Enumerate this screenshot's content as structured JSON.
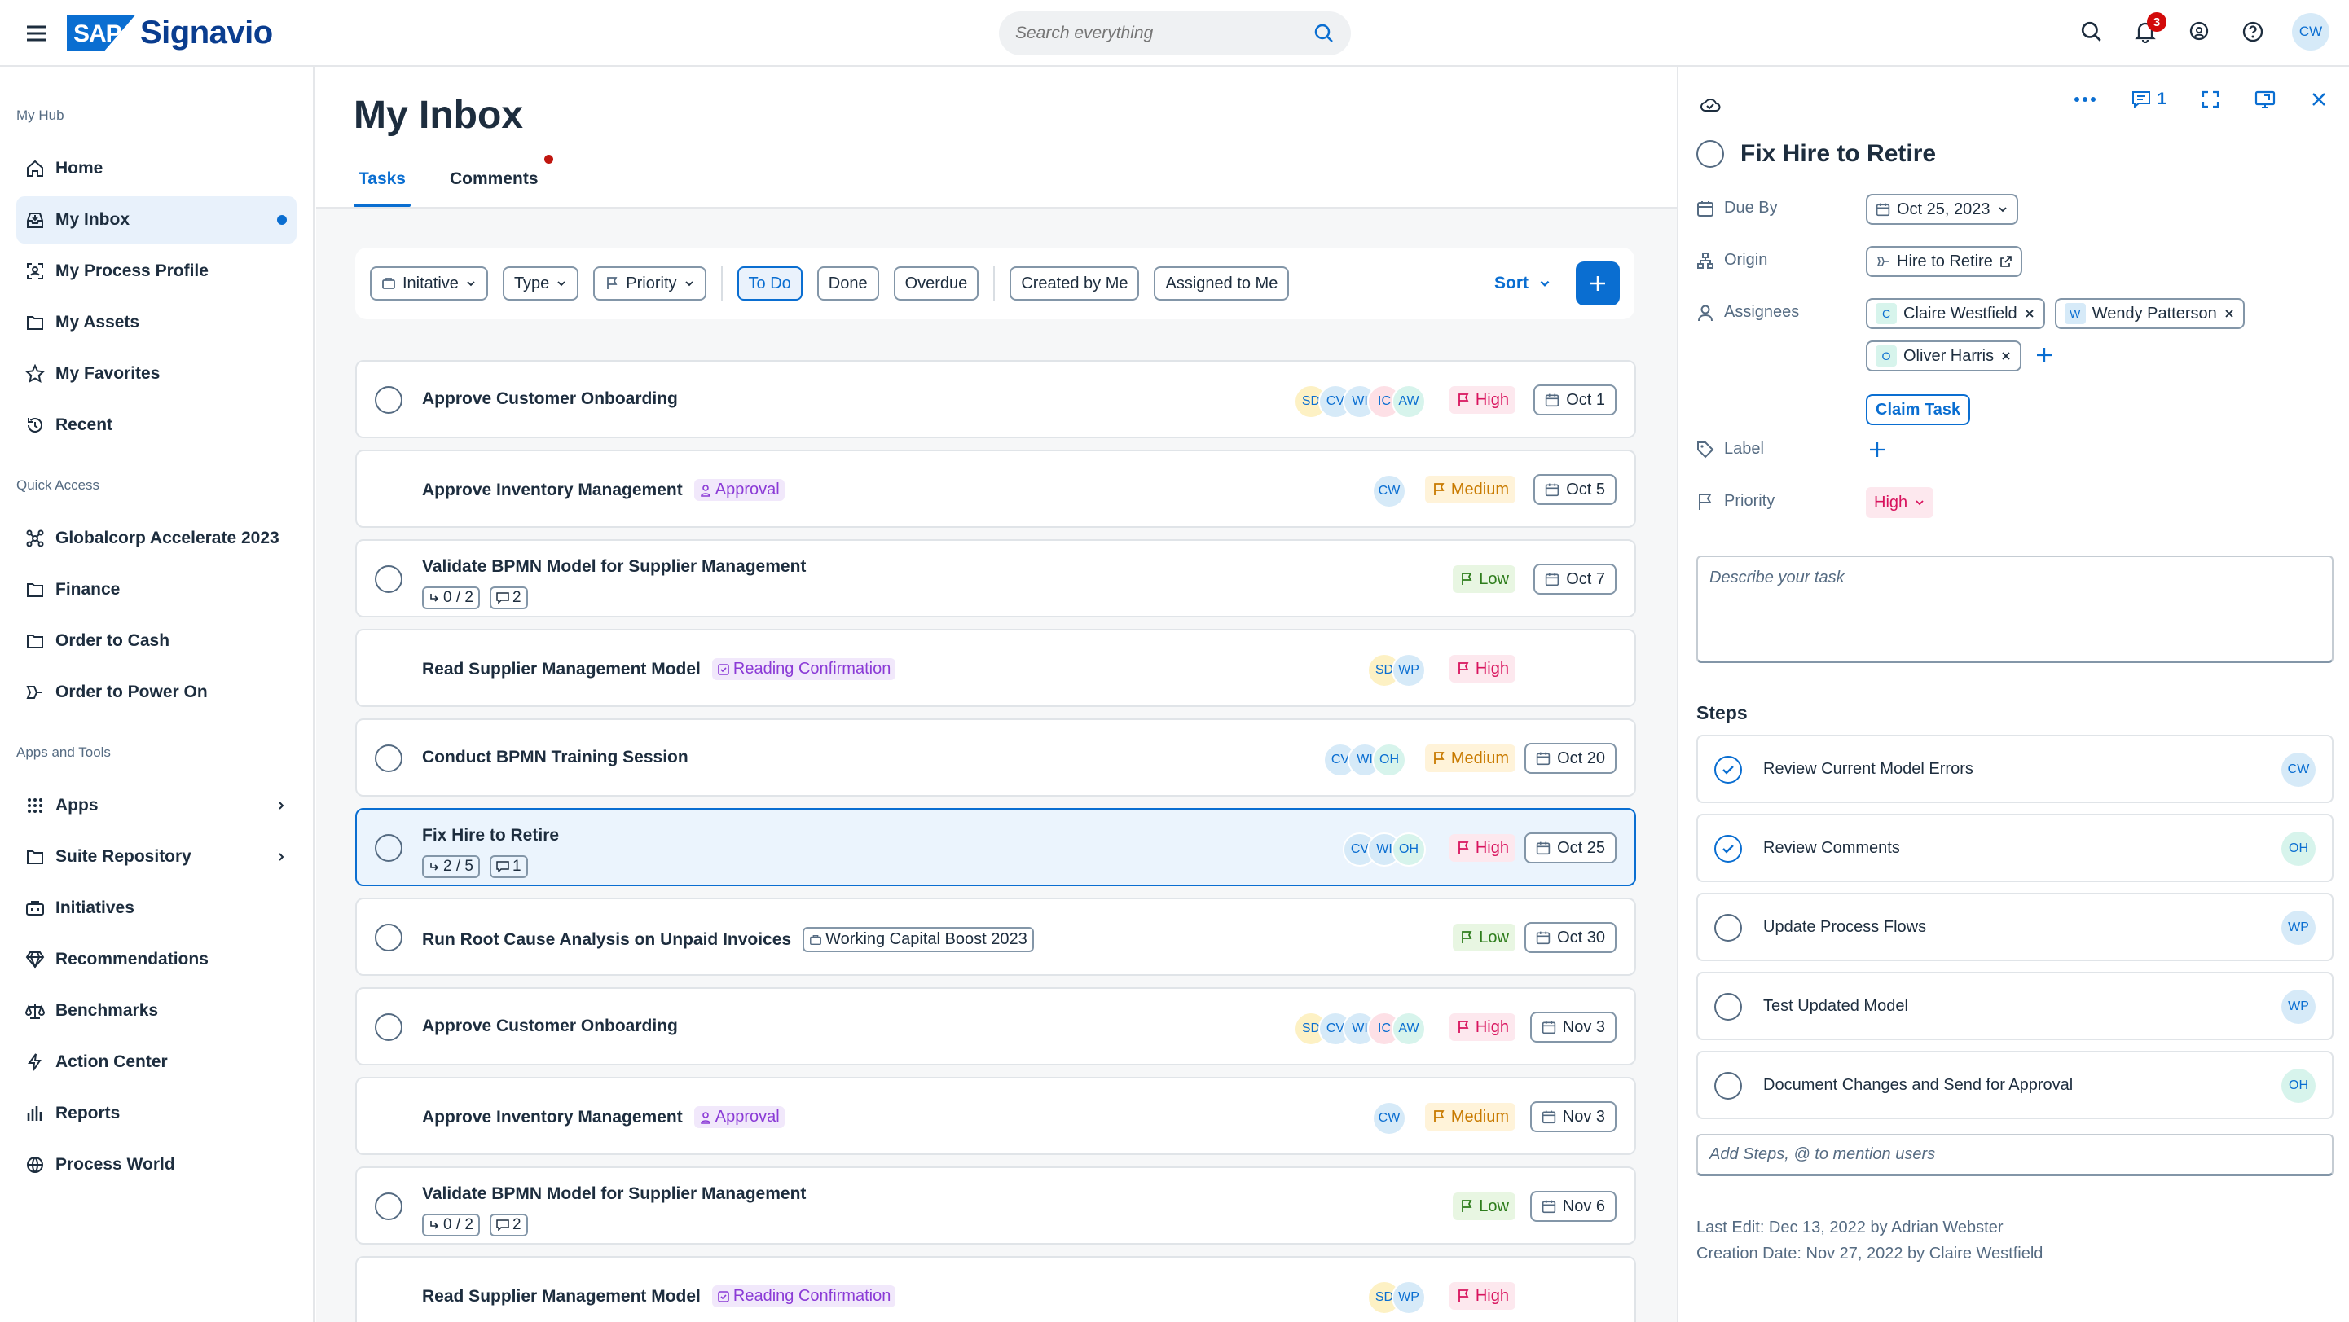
{
  "header": {
    "logo_brand": "SAP",
    "logo_product": "Signavio",
    "search_placeholder": "Search everything",
    "notification_count": "3",
    "user_initials": "CW"
  },
  "sidebar": {
    "sections": [
      {
        "label": "My Hub",
        "items": [
          {
            "label": "Home",
            "icon": "home-icon"
          },
          {
            "label": "My Inbox",
            "icon": "inbox-icon",
            "active": true
          },
          {
            "label": "My Process Profile",
            "icon": "process-profile-icon"
          },
          {
            "label": "My Assets",
            "icon": "folder-icon"
          },
          {
            "label": "My Favorites",
            "icon": "star-icon"
          },
          {
            "label": "Recent",
            "icon": "history-icon"
          }
        ]
      },
      {
        "label": "Quick Access",
        "items": [
          {
            "label": "Globalcorp Accelerate 2023",
            "icon": "network-icon"
          },
          {
            "label": "Finance",
            "icon": "folder-icon"
          },
          {
            "label": "Order to Cash",
            "icon": "folder-icon"
          },
          {
            "label": "Order to Power On",
            "icon": "process-icon"
          }
        ]
      },
      {
        "label": "Apps and Tools",
        "items": [
          {
            "label": "Apps",
            "icon": "grid-icon",
            "chevron": true
          },
          {
            "label": "Suite Repository",
            "icon": "folder-icon",
            "chevron": true
          },
          {
            "label": "Initiatives",
            "icon": "briefcase-icon"
          },
          {
            "label": "Recommendations",
            "icon": "diamond-icon"
          },
          {
            "label": "Benchmarks",
            "icon": "scale-icon"
          },
          {
            "label": "Action Center",
            "icon": "lightning-icon"
          },
          {
            "label": "Reports",
            "icon": "bar-chart-icon"
          },
          {
            "label": "Process World",
            "icon": "globe-icon"
          }
        ]
      }
    ]
  },
  "main": {
    "title": "My Inbox",
    "tabs": [
      "Tasks",
      "Comments"
    ],
    "filters": {
      "initiative": "Initative",
      "type": "Type",
      "priority": "Priority",
      "status": [
        "To Do",
        "Done",
        "Overdue"
      ],
      "owner": [
        "Created by Me",
        "Assigned to Me"
      ],
      "sort": "Sort"
    },
    "tasks": [
      {
        "name": "Approve Customer Onboarding",
        "avatars": [
          "SD",
          "CV",
          "WI",
          "IC",
          "AW"
        ],
        "priority": "High",
        "due": "Oct 1",
        "circle": true
      },
      {
        "name": "Approve Inventory Management",
        "tag": "Approval",
        "tag_kind": "approval",
        "avatars": [
          "CW"
        ],
        "priority": "Medium",
        "due": "Oct 5",
        "circle": false
      },
      {
        "name": "Validate BPMN Model for Supplier Management",
        "subtasks": "0 / 2",
        "comments": "2",
        "avatars": [],
        "priority": "Low",
        "due": "Oct 7",
        "circle": true
      },
      {
        "name": "Read Supplier Management Model",
        "tag": "Reading Confirmation",
        "tag_kind": "reading",
        "avatars": [
          "SD",
          "WP"
        ],
        "priority": "High",
        "due": "",
        "circle": false
      },
      {
        "name": "Conduct BPMN Training Session",
        "avatars": [
          "CV",
          "WI",
          "OH"
        ],
        "priority": "Medium",
        "due": "Oct 20",
        "circle": true
      },
      {
        "name": "Fix Hire to Retire",
        "subtasks": "2 / 5",
        "comments": "1",
        "avatars": [
          "CV",
          "WI",
          "OH"
        ],
        "priority": "High",
        "due": "Oct 25",
        "circle": true,
        "selected": true
      },
      {
        "name": "Run Root Cause Analysis on Unpaid Invoices",
        "tag": "Working Capital Boost 2023",
        "tag_kind": "init",
        "avatars": [],
        "priority": "Low",
        "due": "Oct 30",
        "circle": true
      },
      {
        "name": "Approve Customer Onboarding",
        "avatars": [
          "SD",
          "CV",
          "WI",
          "IC",
          "AW"
        ],
        "priority": "High",
        "due": "Nov 3",
        "circle": true
      },
      {
        "name": "Approve Inventory Management",
        "tag": "Approval",
        "tag_kind": "approval",
        "avatars": [
          "CW"
        ],
        "priority": "Medium",
        "due": "Nov 3",
        "circle": false
      },
      {
        "name": "Validate BPMN Model for Supplier Management",
        "subtasks": "0 / 2",
        "comments": "2",
        "avatars": [],
        "priority": "Low",
        "due": "Nov 6",
        "circle": true
      },
      {
        "name": "Read Supplier Management Model",
        "tag": "Reading Confirmation",
        "tag_kind": "reading",
        "avatars": [
          "SD",
          "WP"
        ],
        "priority": "High",
        "due": "",
        "circle": false
      }
    ]
  },
  "panel": {
    "comment_count": "1",
    "title": "Fix Hire to Retire",
    "labels": {
      "due": "Due By",
      "origin": "Origin",
      "assignees": "Assignees",
      "label": "Label",
      "priority": "Priority"
    },
    "due": "Oct 25, 2023",
    "origin": "Hire to Retire",
    "assignees": [
      {
        "initial": "C",
        "name": "Claire Westfield"
      },
      {
        "initial": "W",
        "name": "Wendy Patterson"
      },
      {
        "initial": "O",
        "name": "Oliver Harris"
      }
    ],
    "claim_label": "Claim Task",
    "priority": "High",
    "description_placeholder": "Describe your task",
    "steps_title": "Steps",
    "steps": [
      {
        "label": "Review Current Model Errors",
        "done": true,
        "avatar": "CW"
      },
      {
        "label": "Review Comments",
        "done": true,
        "avatar": "OH"
      },
      {
        "label": "Update Process Flows",
        "done": false,
        "avatar": "WP"
      },
      {
        "label": "Test Updated Model",
        "done": false,
        "avatar": "WP"
      },
      {
        "label": "Document Changes and Send for Approval",
        "done": false,
        "avatar": "OH"
      }
    ],
    "add_steps_placeholder": "Add Steps, @ to mention users",
    "last_edit": "Last Edit: Dec 13, 2022 by Adrian Webster",
    "creation_date": "Creation Date: Nov 27, 2022 by Claire Westfield"
  },
  "colors": {
    "accent": "#0a6ed1",
    "avatar_SD": "#fdf1c4",
    "avatar_CV": "#d6eaf8",
    "avatar_WI": "#d6eaf8",
    "avatar_IC": "#fde0e6",
    "avatar_AW": "#d7f4ec",
    "avatar_CW": "#d6eaf8",
    "avatar_WP": "#d6eaf8",
    "avatar_OH": "#d7f4ec"
  }
}
